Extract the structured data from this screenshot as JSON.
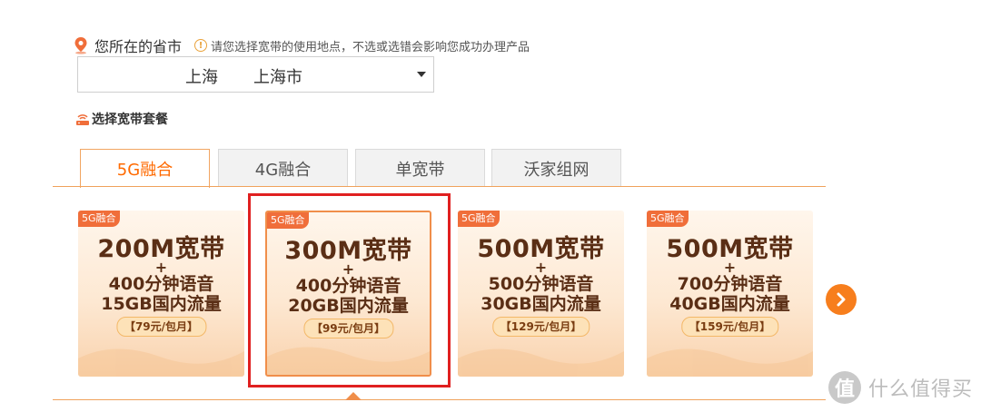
{
  "location": {
    "label": "您所在的省市",
    "hint": "请您选择宽带的使用地点，不选或选错会影响您成功办理产品",
    "province": "上海",
    "city": "上海市"
  },
  "package_section": {
    "label": "选择宽带套餐"
  },
  "tabs": [
    {
      "label": "5G融合",
      "active": true
    },
    {
      "label": "4G融合",
      "active": false
    },
    {
      "label": "单宽带",
      "active": false
    },
    {
      "label": "沃家组网",
      "active": false
    }
  ],
  "cards": [
    {
      "tag": "5G融合",
      "title": "200M宽带",
      "plus": "+",
      "voice": "400分钟语音",
      "data": "15GB国内流量",
      "price": "【79元/包月】",
      "selected": false
    },
    {
      "tag": "5G融合",
      "title": "300M宽带",
      "plus": "+",
      "voice": "400分钟语音",
      "data": "20GB国内流量",
      "price": "【99元/包月】",
      "selected": true
    },
    {
      "tag": "5G融合",
      "title": "500M宽带",
      "plus": "+",
      "voice": "500分钟语音",
      "data": "30GB国内流量",
      "price": "【129元/包月】",
      "selected": false
    },
    {
      "tag": "5G融合",
      "title": "500M宽带",
      "plus": "+",
      "voice": "700分钟语音",
      "data": "40GB国内流量",
      "price": "【159元/包月】",
      "selected": false
    }
  ],
  "watermark": {
    "logo": "值",
    "text": "什么值得买"
  },
  "colors": {
    "accent": "#ff6a00",
    "highlight": "#e02020"
  }
}
